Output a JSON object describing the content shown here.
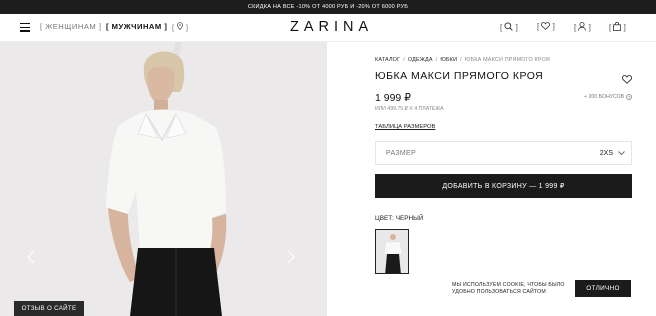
{
  "promo": {
    "text": "СКИДКА НА ВСЕ -10% ОТ 4000 РУБ И -20% ОТ 6000 РУБ"
  },
  "header": {
    "nav_women": "[ ЖЕНЩИНАМ ]",
    "nav_men": "[ МУЖЧИНАМ ]",
    "logo": "ZARINA",
    "icons": [
      "menu-icon",
      "location-pin-icon",
      "search-icon",
      "heart-icon",
      "user-icon",
      "bag-icon"
    ]
  },
  "gallery": {
    "review_button": "ОТЗЫВ О САЙТЕ",
    "icons": [
      "chevron-left-icon",
      "chevron-right-icon"
    ]
  },
  "product": {
    "breadcrumb": [
      "КАТАЛОГ",
      "ОДЕЖДА",
      "ЮБКИ",
      "ЮБКА МАКСИ ПРЯМОГО КРОЯ"
    ],
    "title": "ЮБКА МАКСИ ПРЯМОГО КРОЯ",
    "price": "1 999 ₽",
    "bonus": "+ 200 БОНУСОВ",
    "installment": "ИЛИ 499.75 ₽ Х 4 ПЛАТЕЖА",
    "size_table_link": "ТАБЛИЦА РАЗМЕРОВ",
    "size_label": "РАЗМЕР",
    "size_value": "2XS",
    "add_to_cart": "ДОБАВИТЬ В КОРЗИНУ — 1 999 ₽",
    "color_label": "ЦВЕТ: ЧЕРНЫЙ"
  },
  "cookie": {
    "text_line1": "МЫ ИСПОЛЬЗУЕМ COOKIE, ЧТОБЫ БЫЛО",
    "text_line2": "УДОБНО ПОЛЬЗОВАТЬСЯ САЙТОМ",
    "ok_button": "ОТЛИЧНО"
  },
  "colors": {
    "dark": "#1b1b1b",
    "photo_bg": "#eceaea"
  }
}
